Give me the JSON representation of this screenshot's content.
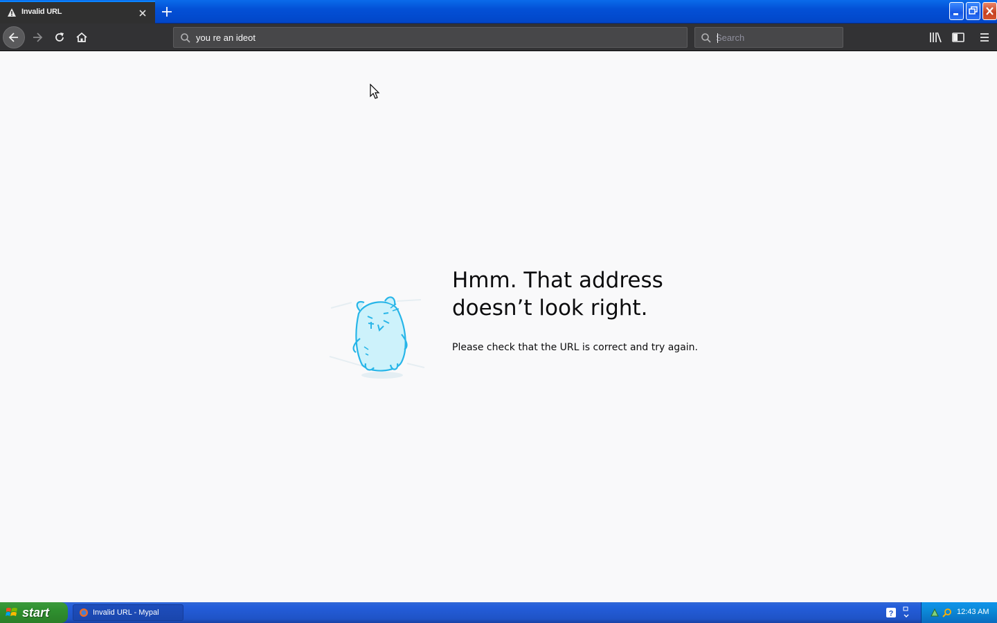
{
  "browser": {
    "tab": {
      "title": "Invalid URL",
      "icon": "warning-icon"
    },
    "url_value": "you re an ideot",
    "search_placeholder": "Search"
  },
  "error_page": {
    "title": "Hmm. That address doesn’t look right.",
    "description": "Please check that the URL is correct and try again."
  },
  "taskbar": {
    "start_label": "start",
    "task_item_label": "Invalid URL - Mypal",
    "clock": "12:43 AM"
  },
  "colors": {
    "titlebar_blue": "#0350d6",
    "toolbar_dark": "#323234",
    "page_background": "#f9f9fa",
    "start_green": "#2f8f2f",
    "tray_blue": "#0c8ad8"
  }
}
